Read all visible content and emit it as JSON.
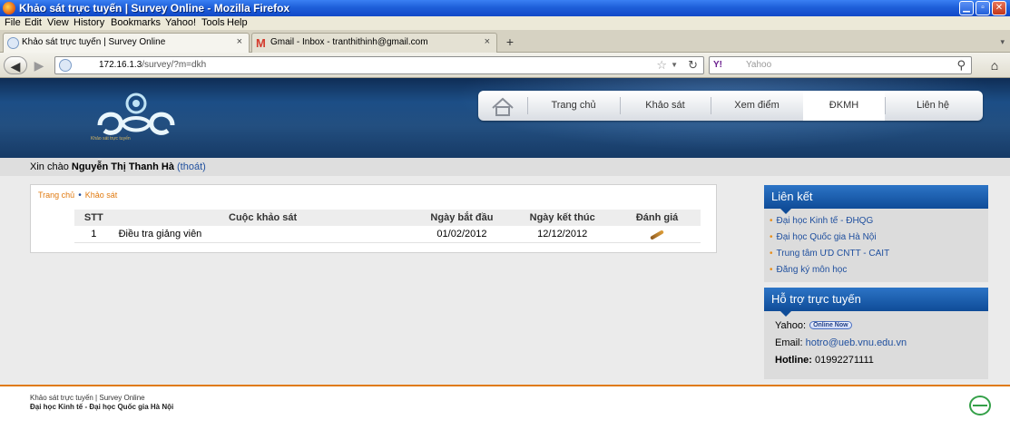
{
  "window": {
    "title": "Khảo sát trực tuyến | Survey Online - Mozilla Firefox"
  },
  "menu": [
    "File",
    "Edit",
    "View",
    "History",
    "Bookmarks",
    "Yahoo!",
    "Tools",
    "Help"
  ],
  "tabs": [
    {
      "label": "Khảo sát trực tuyến | Survey Online",
      "active": true
    },
    {
      "label": "Gmail - Inbox - tranthithinh@gmail.com",
      "active": false
    }
  ],
  "nav": {
    "url_host": "172.16.1.3",
    "url_path": "/survey/?m=dkh",
    "search_placeholder": "Yahoo",
    "search_engine": "Y!"
  },
  "site": {
    "logo_caption": "Khảo sát trực tuyến",
    "menu": [
      "Trang chủ",
      "Khảo sát",
      "Xem điểm",
      "ĐKMH",
      "Liên hệ"
    ],
    "active_menu": "ĐKMH"
  },
  "greeting": {
    "prefix": "Xin chào",
    "name": "Nguyễn Thị Thanh Hà",
    "logout": "(thoát)"
  },
  "breadcrumb": [
    "Trang chủ",
    "Khảo sát"
  ],
  "table": {
    "headers": [
      "STT",
      "Cuộc khảo sát",
      "Ngày bắt đầu",
      "Ngày kết thúc",
      "Đánh giá"
    ],
    "rows": [
      {
        "stt": "1",
        "name": "Điều tra giảng viên",
        "start": "01/02/2012",
        "end": "12/12/2012"
      }
    ]
  },
  "links_box": {
    "title": "Liên kết",
    "items": [
      "Đại học Kinh tế - ĐHQG",
      "Đại học Quốc gia Hà Nội",
      "Trung tâm ƯD CNTT - CAIT",
      "Đăng ký môn học"
    ]
  },
  "support_box": {
    "title": "Hỗ trợ trực tuyến",
    "yahoo_label": "Yahoo:",
    "online_badge": "Online Now",
    "email_label": "Email:",
    "email": "hotro@ueb.vnu.edu.vn",
    "hotline_label": "Hotline:",
    "hotline": "01992271111"
  },
  "footer": {
    "line1": "Khảo sát trực tuyến | Survey Online",
    "line2": "Đại học Kinh tế - Đại học Quốc gia Hà Nội"
  },
  "colors": {
    "titlebar": "#1E5FD9",
    "banner": "#1C4E86",
    "accent_orange": "#E07A10",
    "link_blue": "#1F4F9E",
    "sidebox_head": "#0F4C98"
  }
}
